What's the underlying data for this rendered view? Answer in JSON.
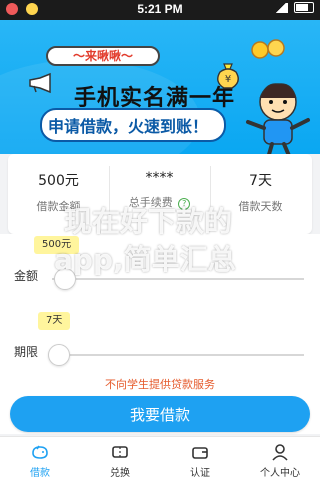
{
  "status_bar": {
    "time": "5:21 PM"
  },
  "banner": {
    "tag": "～来啾啾～",
    "line1": "手机实名满一年",
    "line2": "申请借款，火速到账！"
  },
  "loan_summary": {
    "amount_value": "500元",
    "amount_label": "借款金额",
    "fee_value": "****",
    "fee_label": "总手续费",
    "days_value": "7天",
    "days_label": "借款天数"
  },
  "form": {
    "amount_tip": "500元",
    "amount_label": "金额",
    "period_tip": "7天",
    "period_label": "期限",
    "notice": "不向学生提供贷款服务",
    "apply_button": "我要借款"
  },
  "watermark": {
    "line1": "现在好下款的",
    "line2": "app,简单汇总"
  },
  "nav": {
    "items": [
      {
        "label": "借款",
        "icon": "piggy-bank-icon"
      },
      {
        "label": "兑换",
        "icon": "ticket-icon"
      },
      {
        "label": "认证",
        "icon": "wallet-icon"
      },
      {
        "label": "个人中心",
        "icon": "user-icon"
      }
    ]
  },
  "colors": {
    "primary": "#1ea1f2",
    "banner": "#29b6f6",
    "notice": "#e55a2b",
    "tip": "#fff59d"
  }
}
